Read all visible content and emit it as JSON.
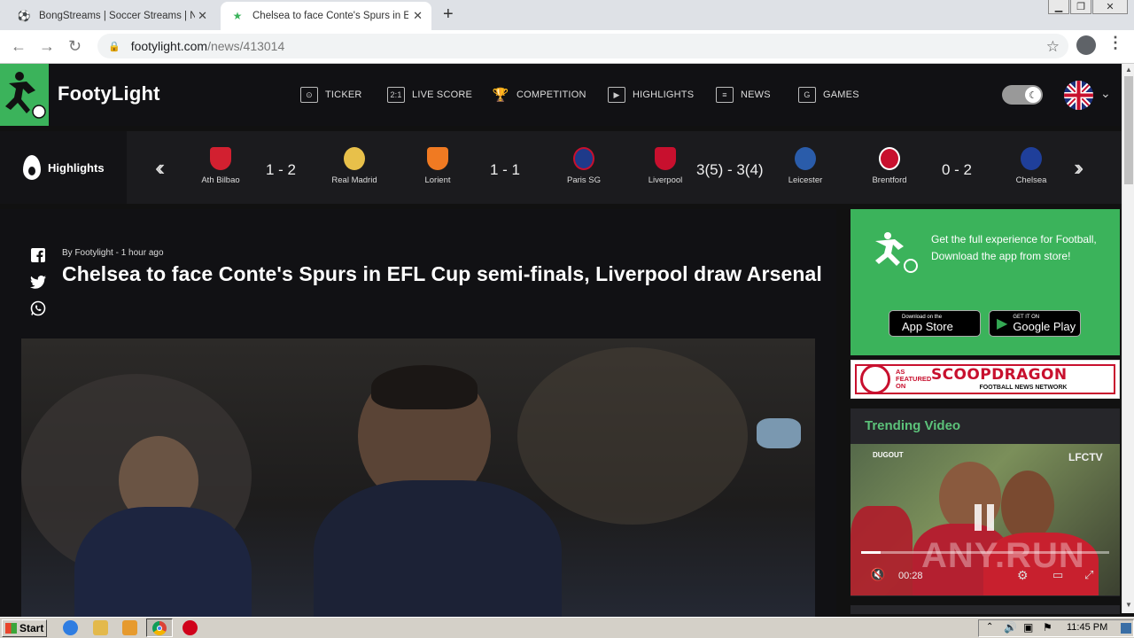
{
  "browser": {
    "tabs": [
      {
        "title": "BongStreams | Soccer Streams | NBA"
      },
      {
        "title": "Chelsea to face Conte's Spurs in EFL"
      }
    ],
    "url_host": "footylight.com",
    "url_path": "/news/413014"
  },
  "site": {
    "brand": "FootyLight",
    "nav": [
      {
        "label": "TICKER",
        "icon": "ticker-icon"
      },
      {
        "label": "LIVE SCORE",
        "icon": "live-score-icon"
      },
      {
        "label": "COMPETITION",
        "icon": "trophy-icon"
      },
      {
        "label": "HIGHLIGHTS",
        "icon": "play-icon"
      },
      {
        "label": "NEWS",
        "icon": "news-icon"
      },
      {
        "label": "GAMES",
        "icon": "games-icon"
      }
    ]
  },
  "scores": {
    "section_label": "Highlights",
    "matches": [
      {
        "home": "Ath Bilbao",
        "score": "1 - 2",
        "away": "Real Madrid",
        "home_color": "#d22030",
        "away_color": "#e8c04a"
      },
      {
        "home": "Lorient",
        "score": "1 - 1",
        "away": "Paris SG",
        "home_color": "#f07a22",
        "away_color": "#1e3a8a"
      },
      {
        "home": "Liverpool",
        "score": "3(5) - 3(4)",
        "away": "Leicester",
        "home_color": "#c8102e",
        "away_color": "#2a5caa"
      },
      {
        "home": "Brentford",
        "score": "0 - 2",
        "away": "Chelsea",
        "home_color": "#c8102e",
        "away_color": "#1f3f9a"
      }
    ]
  },
  "article": {
    "byline": "By Footylight - 1 hour ago",
    "headline": "Chelsea to face Conte's Spurs in EFL Cup semi-finals, Liverpool draw Arsenal"
  },
  "sidebar": {
    "app_promo": "Get the full experience for Football, Download the app from store!",
    "app_store": {
      "small": "Download on the",
      "big": "App Store"
    },
    "google_play": {
      "small": "GET IT ON",
      "big": "Google Play"
    },
    "scoop": {
      "as_featured": "AS FEATURED ON",
      "name": "SCOOPDRAGON",
      "sub": "FOOTBALL NEWS NETWORK"
    },
    "trending_title": "Trending Video",
    "video": {
      "channel": "LFCTV",
      "overlay": "DUGOUT",
      "time": "00:28",
      "watermark": "ANY.RUN"
    }
  },
  "taskbar": {
    "start": "Start",
    "clock": "11:45 PM"
  },
  "colors": {
    "brand_green": "#3bb35b",
    "trending_green": "#5cc27a"
  }
}
